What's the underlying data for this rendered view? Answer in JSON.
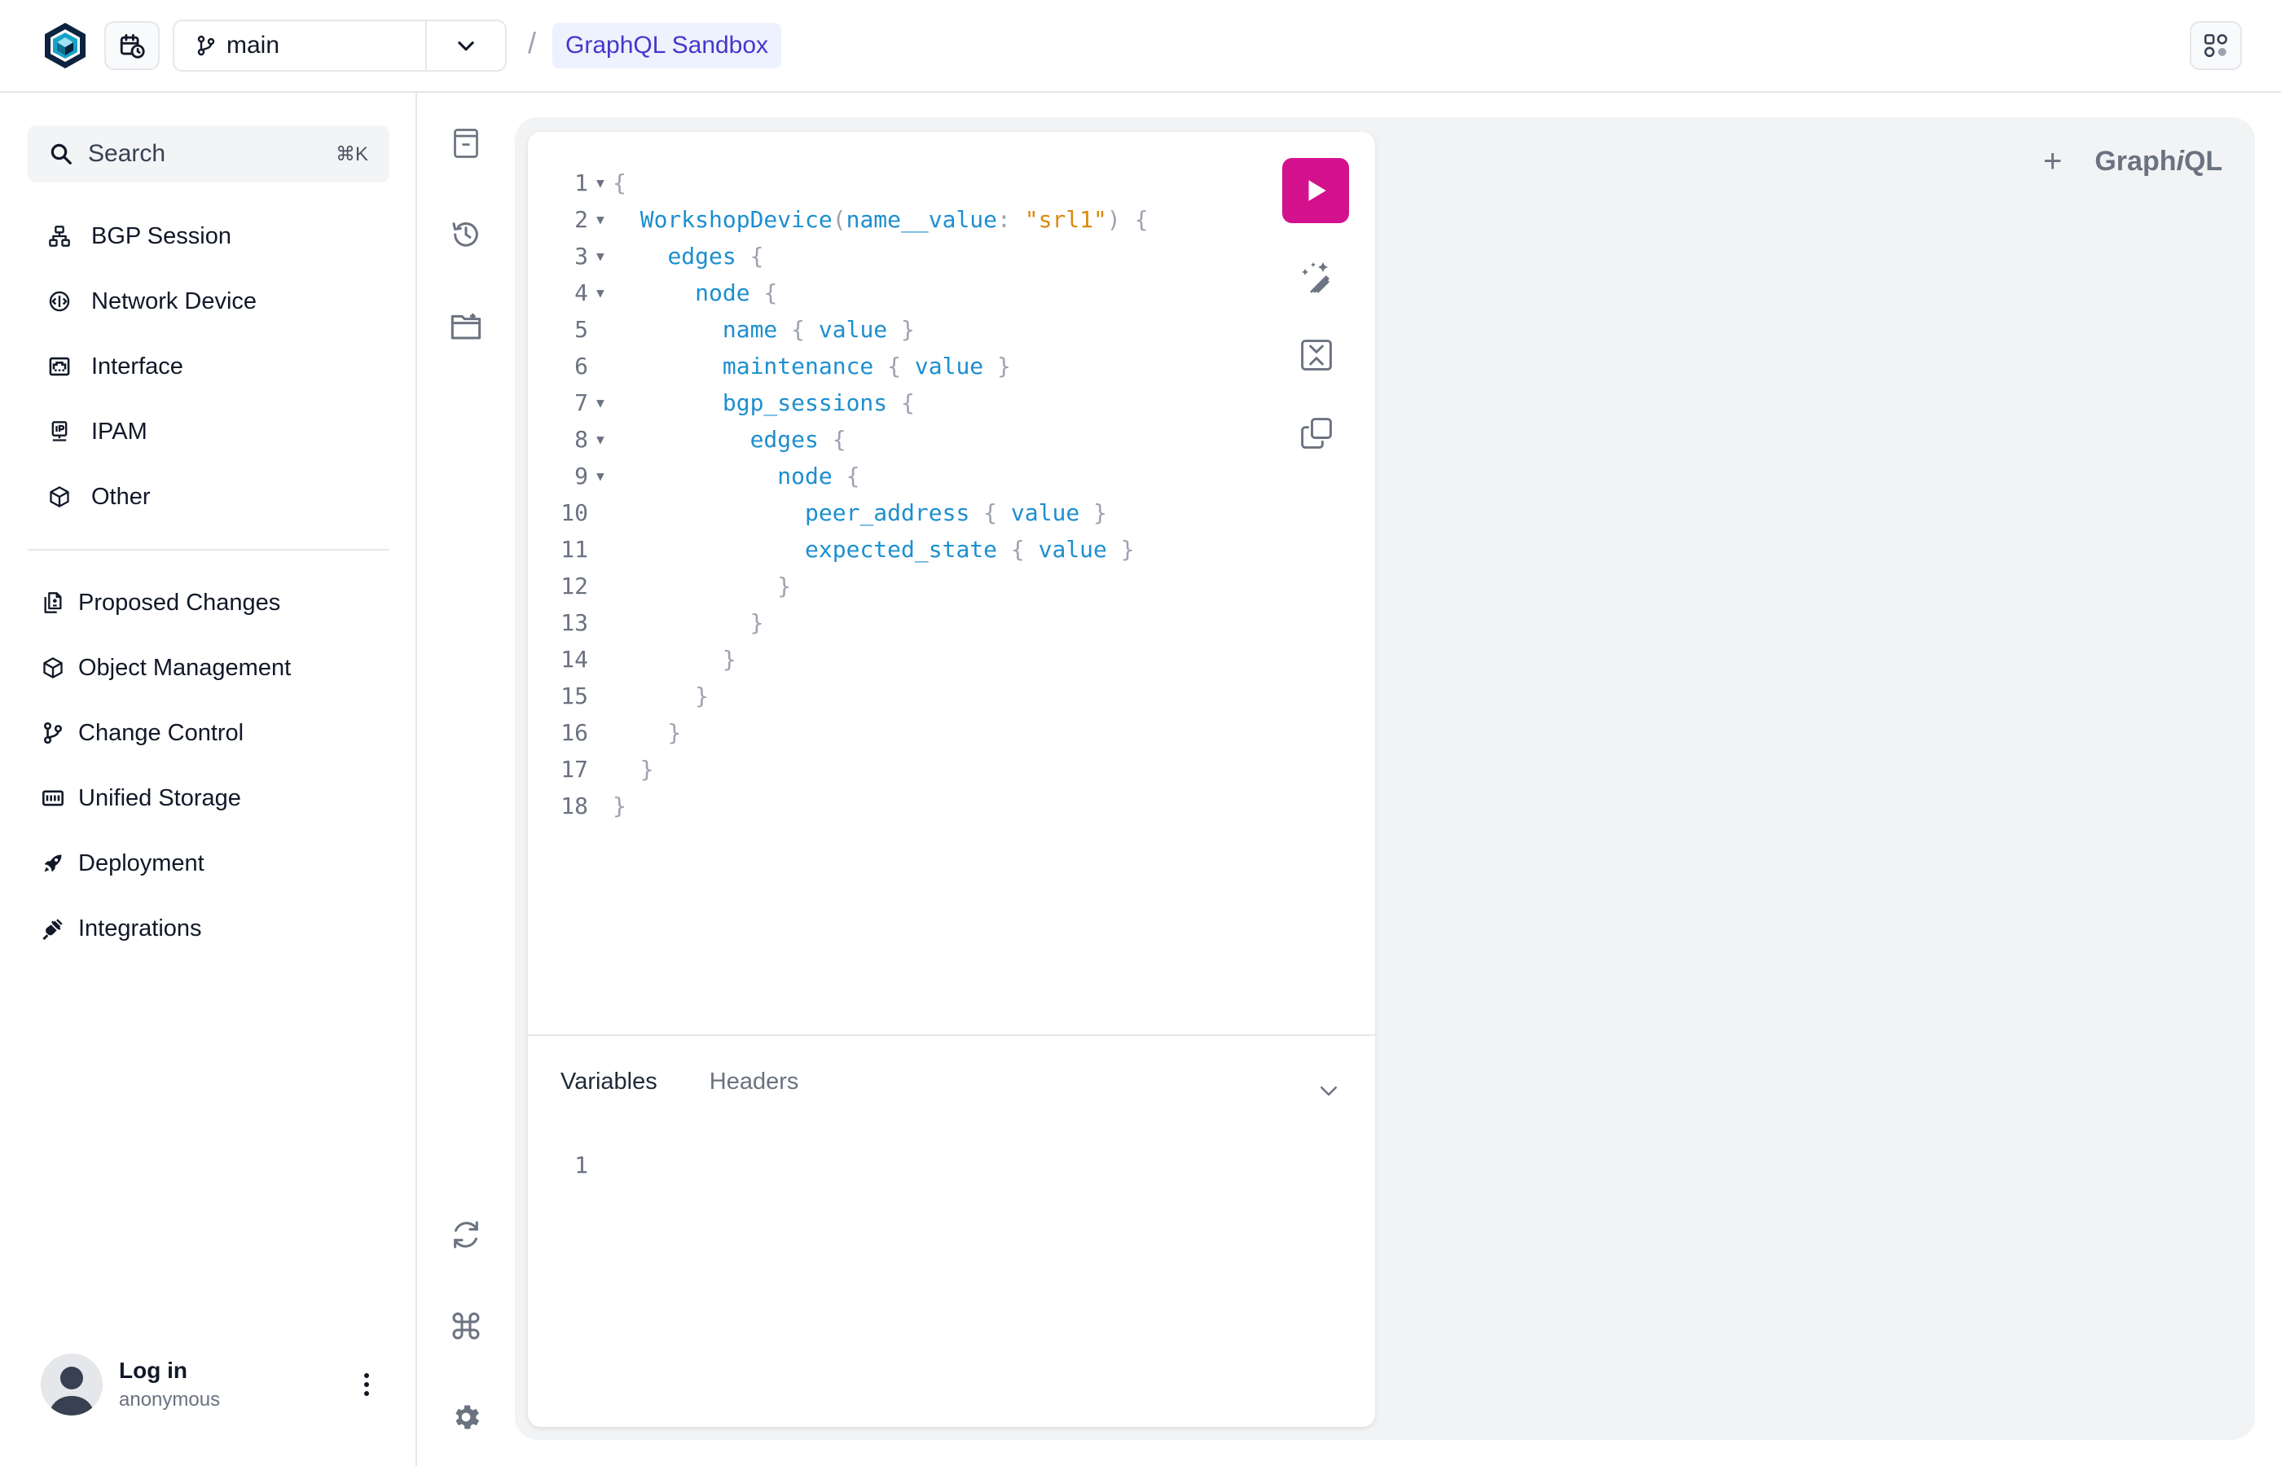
{
  "header": {
    "branch": "main",
    "breadcrumb_sep": "/",
    "breadcrumb": "GraphQL Sandbox"
  },
  "sidebar": {
    "search_label": "Search",
    "search_shortcut": "⌘K",
    "schema_items": [
      {
        "label": "BGP Session",
        "icon": "network-icon"
      },
      {
        "label": "Network Device",
        "icon": "device-icon"
      },
      {
        "label": "Interface",
        "icon": "ethernet-port-icon"
      },
      {
        "label": "IPAM",
        "icon": "ip-icon"
      },
      {
        "label": "Other",
        "icon": "cube-icon"
      }
    ],
    "menu_items": [
      {
        "label": "Proposed Changes",
        "icon": "file-diff-icon"
      },
      {
        "label": "Object Management",
        "icon": "cube-icon"
      },
      {
        "label": "Change Control",
        "icon": "branch-icon"
      },
      {
        "label": "Unified Storage",
        "icon": "storage-icon"
      },
      {
        "label": "Deployment",
        "icon": "rocket-icon"
      },
      {
        "label": "Integrations",
        "icon": "plug-icon"
      }
    ],
    "user": {
      "name": "Log in",
      "subtitle": "anonymous"
    }
  },
  "main": {
    "plus_label": "+",
    "brand_prefix": "Graph",
    "brand_italic": "i",
    "brand_suffix": "QL"
  },
  "editor": {
    "lines": [
      "{",
      "  WorkshopDevice(name__value: \"srl1\") {",
      "    edges {",
      "      node {",
      "        name { value }",
      "        maintenance { value }",
      "        bgp_sessions {",
      "          edges {",
      "            node {",
      "              peer_address { value }",
      "              expected_state { value }",
      "            }",
      "          }",
      "        }",
      "      }",
      "    }",
      "  }",
      "}"
    ],
    "foldable_lines": [
      1,
      2,
      3,
      4,
      7,
      8,
      9
    ],
    "run_color": "#d4118c"
  },
  "variables": {
    "tabs": [
      "Variables",
      "Headers"
    ],
    "active_tab": "Variables",
    "line_numbers": [
      "1"
    ]
  }
}
